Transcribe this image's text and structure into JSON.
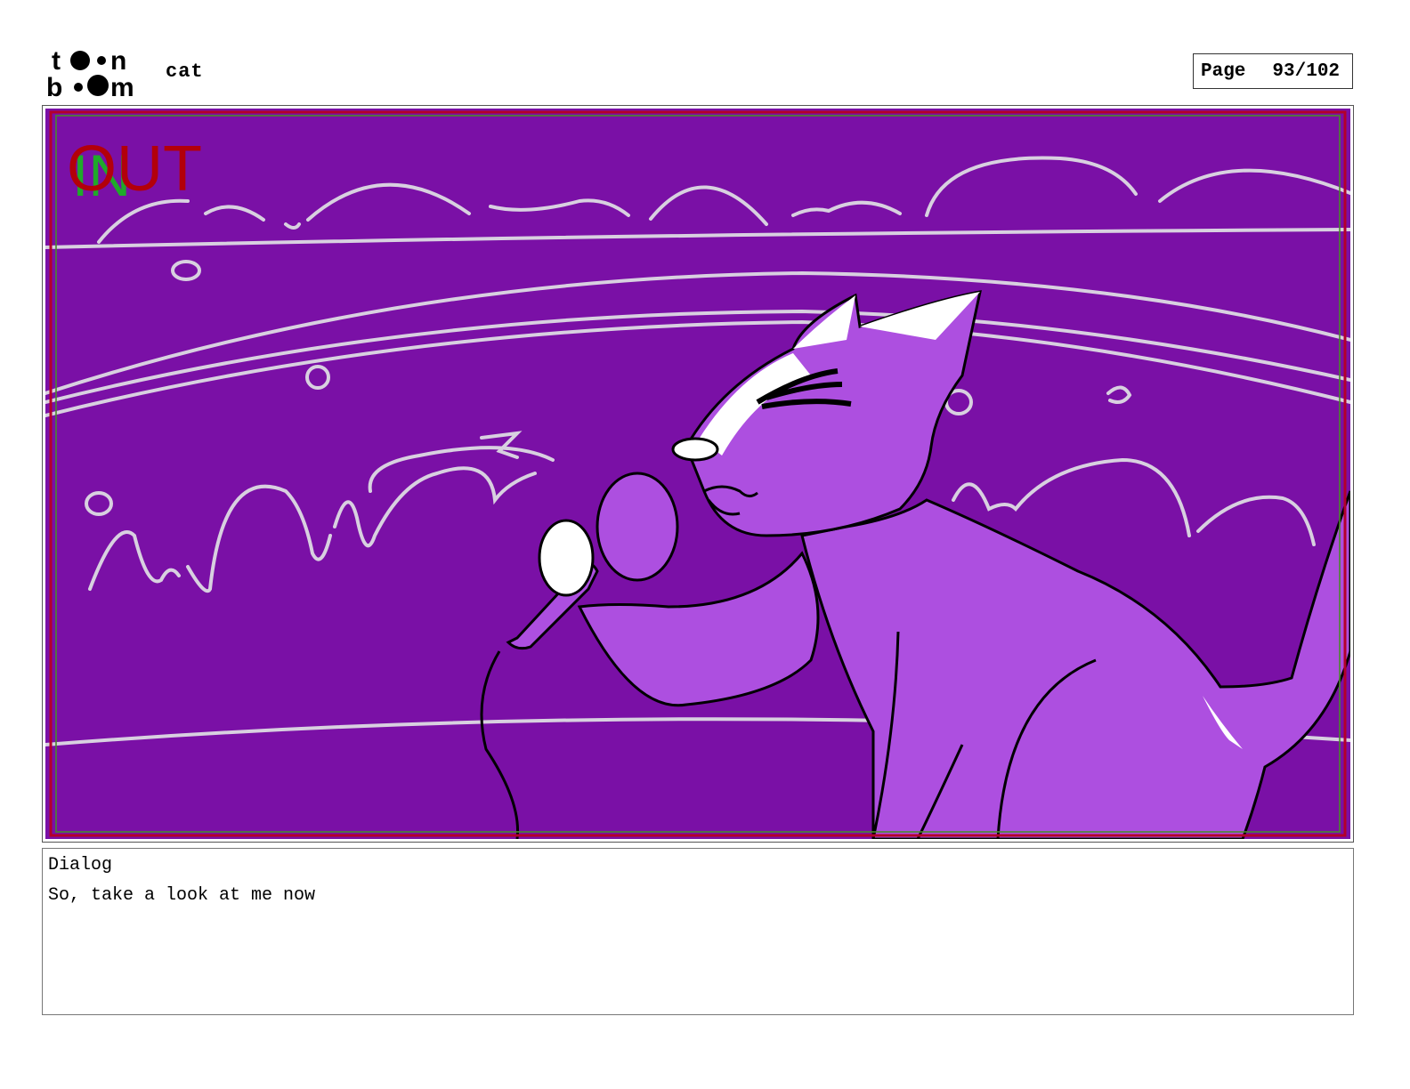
{
  "header": {
    "logo_top": "toon",
    "logo_bottom": "boom",
    "project_title": "cat",
    "page_label": "Page",
    "page_value": "93/102"
  },
  "panel": {
    "background_color": "#7a10a6",
    "cat_fill_color": "#ad4fe0",
    "in_marker": "IN",
    "out_marker": "OUT",
    "in_color": "#1faa2a",
    "out_color": "#b3000a",
    "safe_frame_colors": [
      "#b3002a",
      "#4a8a2a"
    ]
  },
  "dialog": {
    "label": "Dialog",
    "text": "So, take a look at me now"
  }
}
